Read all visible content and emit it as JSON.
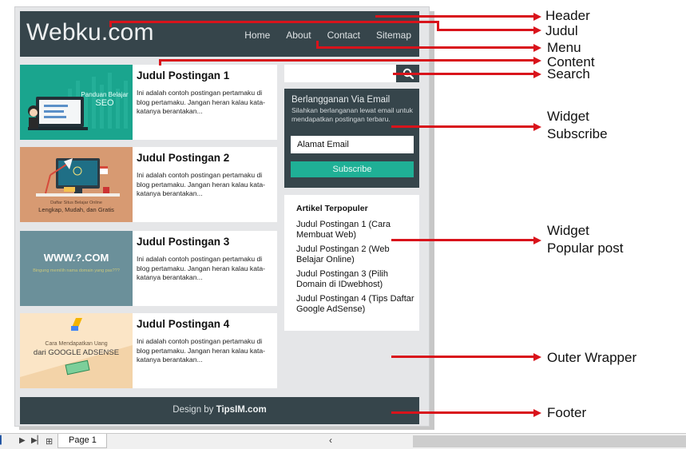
{
  "site": {
    "title": "Webku.com",
    "menu": [
      "Home",
      "About",
      "Contact",
      "Sitemap"
    ]
  },
  "posts": [
    {
      "title": "Judul Postingan 1",
      "excerpt": "Ini adalah contoh postingan pertamaku di blog pertamaku. Jangan heran kalau kata-katanya berantakan...",
      "thumb": {
        "line1": "Panduan Belajar",
        "line2": "SEO",
        "bg": "#1aa58e"
      }
    },
    {
      "title": "Judul Postingan 2",
      "excerpt": "Ini adalah contoh postingan pertamaku di blog pertamaku. Jangan heran kalau kata-katanya berantakan...",
      "thumb": {
        "line1": "Daftar Situs Belajar Online",
        "line2": "Lengkap, Mudah, dan Gratis",
        "bg": "#d79a72"
      }
    },
    {
      "title": "Judul Postingan 3",
      "excerpt": "Ini adalah contoh postingan pertamaku di blog pertamaku. Jangan heran kalau kata-katanya berantakan...",
      "thumb": {
        "line1": "WWW.?.COM",
        "line2": "Bingung memilih nama domain yang pas???",
        "bg": "#6b909a"
      }
    },
    {
      "title": "Judul Postingan 4",
      "excerpt": "Ini adalah contoh postingan pertamaku di blog pertamaku. Jangan heran kalau kata-katanya berantakan...",
      "thumb": {
        "line1": "Cara Mendapatkan Uang",
        "line2": "dari GOOGLE ADSENSE",
        "bg": "#fbe5c6"
      }
    }
  ],
  "search": {
    "placeholder": "",
    "icon": "search-icon"
  },
  "subscribe": {
    "title": "Berlangganan Via Email",
    "description": "Silahkan berlanganan lewat email untuk mendapatkan postingan terbaru.",
    "email_value": "Alamat Email",
    "button_label": "Subscribe"
  },
  "popular": {
    "title": "Artikel Terpopuler",
    "items": [
      "Judul Postingan 1 (Cara Membuat Web)",
      "Judul Postingan 2 (Web Belajar Online)",
      "Judul Postingan 3 (Pilih Domain di IDwebhost)",
      "Judul Postingan 4 (Tips Daftar Google AdSense)"
    ]
  },
  "footer": {
    "prefix": "Design by",
    "brand": "TipsIM.com"
  },
  "annotations": {
    "header": "Header",
    "judul": "Judul",
    "menu": "Menu",
    "content": "Content",
    "search": "Search",
    "widget_subscribe_1": "Widget",
    "widget_subscribe_2": "Subscribe",
    "widget_popular_1": "Widget",
    "widget_popular_2": "Popular post",
    "outer_wrapper": "Outer Wrapper",
    "footer": "Footer"
  },
  "sheetbar": {
    "tab_label": "Page 1"
  },
  "colors": {
    "dark": "#36454b",
    "accent": "#1fb096",
    "arrow": "#d9131b",
    "wrapper": "#e5e6e8"
  }
}
